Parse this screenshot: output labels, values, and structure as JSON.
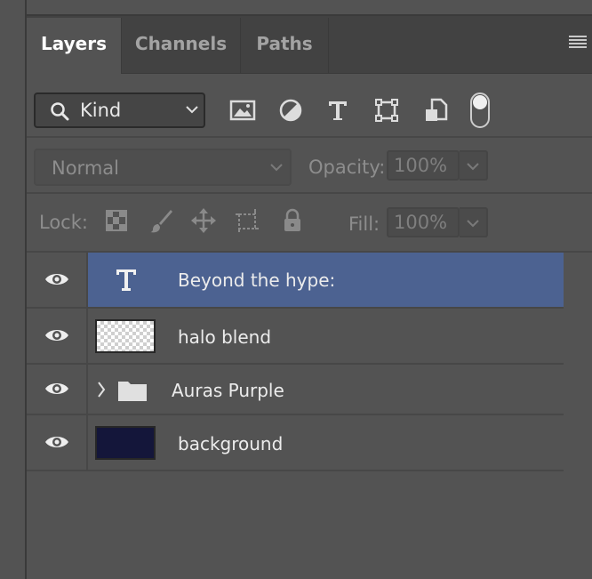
{
  "tabs": [
    {
      "label": "Layers",
      "active": true
    },
    {
      "label": "Channels",
      "active": false
    },
    {
      "label": "Paths",
      "active": false
    }
  ],
  "filter": {
    "kind_label": "Kind",
    "icons": [
      "image-filter-icon",
      "adjustment-filter-icon",
      "type-filter-icon",
      "shape-filter-icon",
      "smart-object-filter-icon"
    ],
    "toggle_on": true
  },
  "blend": {
    "mode": "Normal",
    "opacity_label": "Opacity:",
    "opacity_value": "100%"
  },
  "lock": {
    "label": "Lock:",
    "icons": [
      "lock-transparent-pixels-icon",
      "lock-image-pixels-icon",
      "lock-position-icon",
      "lock-artboard-icon",
      "lock-all-icon"
    ],
    "fill_label": "Fill:",
    "fill_value": "100%"
  },
  "layers": [
    {
      "name": "Beyond the hype:",
      "type": "text",
      "selected": true,
      "visible": true
    },
    {
      "name": "halo blend",
      "type": "transparent",
      "selected": false,
      "visible": true
    },
    {
      "name": "Auras Purple",
      "type": "group",
      "selected": false,
      "visible": true
    },
    {
      "name": "background",
      "type": "fill",
      "color": "#14163a",
      "selected": false,
      "visible": true
    }
  ],
  "colors": {
    "selected_row": "#4c6291",
    "panel_bg": "#535353",
    "tabbar_bg": "#424242"
  }
}
